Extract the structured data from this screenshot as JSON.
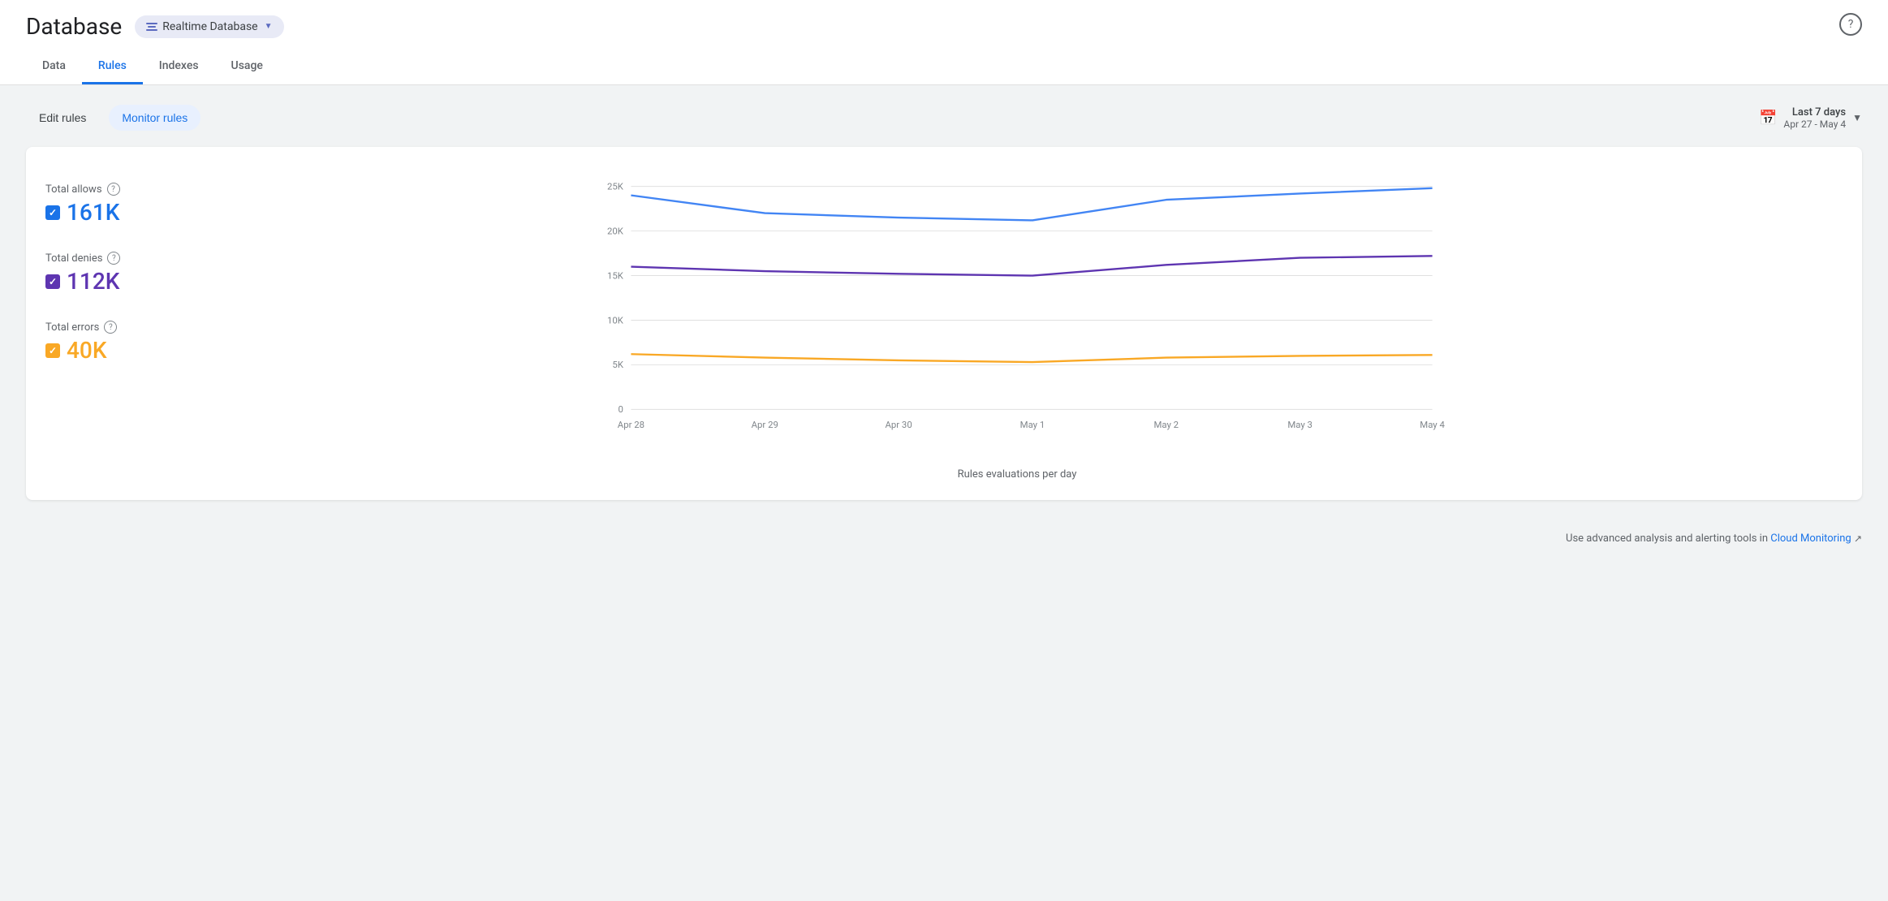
{
  "header": {
    "title": "Database",
    "db_selector": {
      "label": "Realtime Database",
      "chevron": "▼"
    },
    "help_label": "?"
  },
  "nav": {
    "tabs": [
      {
        "id": "data",
        "label": "Data",
        "active": false
      },
      {
        "id": "rules",
        "label": "Rules",
        "active": true
      },
      {
        "id": "indexes",
        "label": "Indexes",
        "active": false
      },
      {
        "id": "usage",
        "label": "Usage",
        "active": false
      }
    ]
  },
  "toolbar": {
    "edit_rules_label": "Edit rules",
    "monitor_rules_label": "Monitor rules",
    "date_range": {
      "main": "Last 7 days",
      "sub": "Apr 27 - May 4"
    }
  },
  "chart": {
    "legend": [
      {
        "id": "allows",
        "label": "Total allows",
        "value": "161K",
        "color_class": "allows",
        "checkbox_class": "blue"
      },
      {
        "id": "denies",
        "label": "Total denies",
        "value": "112K",
        "color_class": "denies",
        "checkbox_class": "purple"
      },
      {
        "id": "errors",
        "label": "Total errors",
        "value": "40K",
        "color_class": "errors",
        "checkbox_class": "yellow"
      }
    ],
    "y_axis": [
      "25K",
      "20K",
      "15K",
      "10K",
      "5K",
      "0"
    ],
    "x_axis": [
      "Apr 28",
      "Apr 29",
      "Apr 30",
      "May 1",
      "May 2",
      "May 3",
      "May 4"
    ],
    "footer_label": "Rules evaluations per day",
    "series": {
      "allows": {
        "color": "#4285f4",
        "points": [
          24000,
          22000,
          21500,
          21200,
          23500,
          24200,
          24800
        ]
      },
      "denies": {
        "color": "#5e35b1",
        "points": [
          16000,
          15500,
          15200,
          15000,
          16200,
          17000,
          17200
        ]
      },
      "errors": {
        "color": "#f9a825",
        "points": [
          6200,
          5800,
          5500,
          5300,
          5800,
          6000,
          6100
        ]
      }
    }
  },
  "footer": {
    "note": "Use advanced analysis and alerting tools in",
    "link_label": "Cloud Monitoring",
    "external_icon": "↗"
  }
}
